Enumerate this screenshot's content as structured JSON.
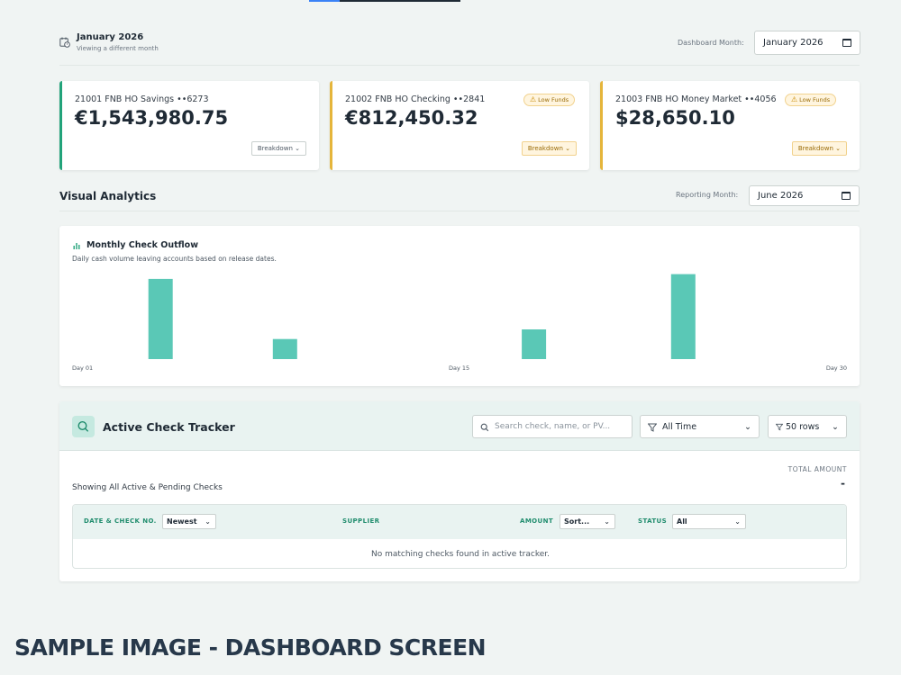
{
  "header": {
    "month_title": "January 2026",
    "month_subtitle": "Viewing a different month",
    "dashboard_month_label": "Dashboard Month:",
    "dashboard_month_value": "January 2026"
  },
  "accounts": [
    {
      "name": "21001 FNB HO Savings ••6273",
      "balance": "€1,543,980.75",
      "low_funds": false,
      "breakdown_label": "Breakdown",
      "accent": "#22a37a"
    },
    {
      "name": "21002 FNB HO Checking ••2841",
      "balance": "€812,450.32",
      "low_funds": true,
      "low_funds_label": "Low Funds",
      "breakdown_label": "Breakdown",
      "accent": "#e5b53b"
    },
    {
      "name": "21003 FNB HO Money Market ••4056",
      "balance": "$28,650.10",
      "low_funds": true,
      "low_funds_label": "Low Funds",
      "breakdown_label": "Breakdown",
      "accent": "#e5b53b"
    }
  ],
  "analytics": {
    "title": "Visual Analytics",
    "reporting_month_label": "Reporting Month:",
    "reporting_month_value": "June 2026"
  },
  "chart_data": {
    "type": "bar",
    "title": "Monthly Check Outflow",
    "subtitle": "Daily cash volume leaving accounts based on release dates.",
    "x_tick_labels": [
      "Day 01",
      "Day 15",
      "Day 30"
    ],
    "x_range": [
      1,
      30
    ],
    "bars": [
      {
        "day": 3,
        "value": 100
      },
      {
        "day": 8,
        "value": 25
      },
      {
        "day": 18,
        "value": 37
      },
      {
        "day": 24,
        "value": 106
      }
    ],
    "ylim": [
      0,
      110
    ],
    "grid": false,
    "bar_color": "#5ac8b6"
  },
  "tracker": {
    "title": "Active Check Tracker",
    "search_placeholder": "Search check, name, or PV...",
    "time_filter": "All Time",
    "rows_filter": "50 rows",
    "showing_text": "Showing All Active & Pending Checks",
    "total_label": "TOTAL AMOUNT",
    "total_value": "-",
    "columns": {
      "date_check": "DATE & CHECK NO.",
      "date_sort": "Newest",
      "supplier": "SUPPLIER",
      "amount": "AMOUNT",
      "amount_sort": "Sort...",
      "status": "STATUS",
      "status_filter": "All"
    },
    "empty_message": "No matching checks found in active tracker."
  },
  "watermark": "SAMPLE IMAGE - DASHBOARD SCREEN"
}
